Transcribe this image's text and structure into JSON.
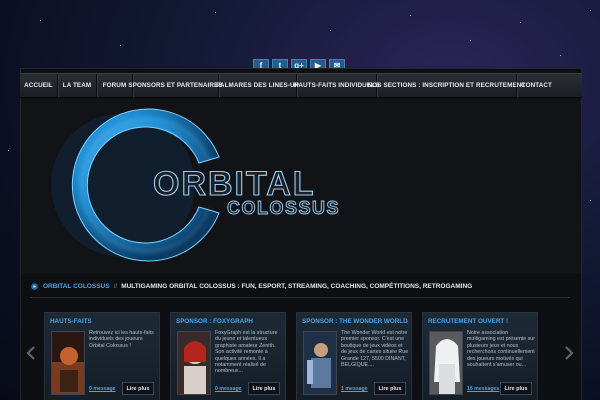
{
  "social": [
    {
      "icon": "facebook-icon",
      "glyph": "f"
    },
    {
      "icon": "twitter-icon",
      "glyph": "t"
    },
    {
      "icon": "google-plus-icon",
      "glyph": "g+"
    },
    {
      "icon": "youtube-icon",
      "glyph": "▶"
    },
    {
      "icon": "mail-icon",
      "glyph": "✉"
    }
  ],
  "nav": [
    {
      "label": "ACCUEIL"
    },
    {
      "label": "LA TEAM"
    },
    {
      "label": "FORUM"
    },
    {
      "label": "SPONSORS ET PARTENAIRES"
    },
    {
      "label": "PALMARES DES LINES-UP"
    },
    {
      "label": "HAUTS-FAITS INDIVIDUELS"
    },
    {
      "label": "NOS SECTIONS : INSCRIPTION ET RECRUTEMENT"
    },
    {
      "label": "CONTACT"
    }
  ],
  "hero": {
    "logo_word": "ORBITAL",
    "logo_sub": "COLOSSUS"
  },
  "breadcrumb": {
    "site": "ORBITAL COLOSSUS",
    "sep": "//",
    "title": "MULTIGAMING ORBITAL COLOSSUS : FUN, ESPORT, STREAMING, COACHING, COMPÉTITIONS, RETROGAMING"
  },
  "cards": [
    {
      "title": "HAUTS-FAITS",
      "desc": "Retrouvez ici les hauts-faits individuels des joueurs Orbital Colossus !",
      "meta": "0 message",
      "more": "Lire plus"
    },
    {
      "title": "SPONSOR : FOXYGRAPH",
      "desc": "FoxyGraph est la structure du jeune et talentueux graphiste amateur Zenith. Son activité remonte à quelques années. Il a notamment réalisé de nombreux...",
      "meta": "0 message",
      "more": "Lire plus"
    },
    {
      "title": "SPONSOR : THE WONDER WORLD",
      "desc": "The Wonder World est notre premier sponsor. C'est une boutique de jeux vidéos et de jeux de cartes située Rue Grande 127, 5500 DINANT, BELGIQUE....",
      "meta": "1 message",
      "more": "Lire plus"
    },
    {
      "title": "RECRUTEMENT OUVERT !",
      "desc": "Notre association multigaming est présente sur plusieurs jeux et nous recherchons continuellement des joueurs motivés qui souhaitent s'amuser ou...",
      "meta": "16 messages",
      "more": "Lire plus"
    }
  ],
  "colors": {
    "accent": "#4aa3e8",
    "nav_text": "#e7e9ee",
    "logo_blue": "#1f8fd6"
  }
}
